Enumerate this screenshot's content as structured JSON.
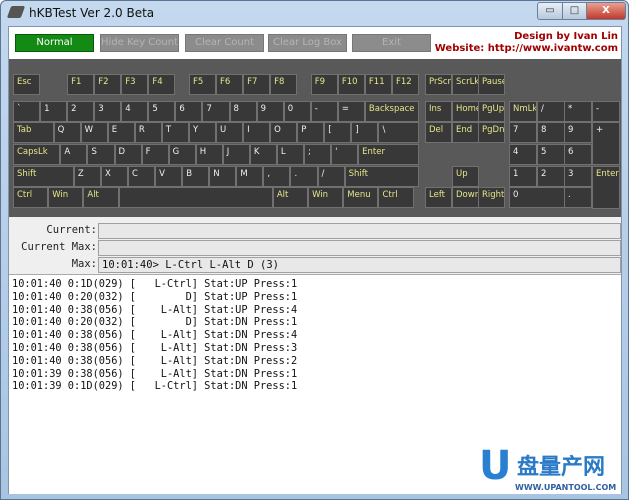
{
  "window": {
    "title": "hKBTest Ver 2.0 Beta",
    "minimize": "▭",
    "maximize": "□",
    "close": "X"
  },
  "toolbar": {
    "buttons": [
      "Normal",
      "Hide Key Count",
      "Clear Count",
      "Clear Log Box",
      "Exit"
    ],
    "credit_line1": "Design by Ivan Lin",
    "credit_line2": "Website: http://www.ivantw.com"
  },
  "keyboard": {
    "rows": [
      [
        "Esc",
        "F1",
        "F2",
        "F3",
        "F4",
        "F5",
        "F6",
        "F7",
        "F8",
        "F9",
        "F10",
        "F11",
        "F12",
        "PrScr",
        "ScrLk",
        "Pause"
      ],
      [
        "`",
        "1",
        "2",
        "3",
        "4",
        "5",
        "6",
        "7",
        "8",
        "9",
        "0",
        "-",
        "=",
        "Backspace",
        "Ins",
        "Home",
        "PgUp",
        "NmLk",
        "/",
        "*",
        "-"
      ],
      [
        "Tab",
        "Q",
        "W",
        "E",
        "R",
        "T",
        "Y",
        "U",
        "I",
        "O",
        "P",
        "[",
        "]",
        "\\",
        "Del",
        "End",
        "PgDn",
        "7",
        "8",
        "9",
        "+"
      ],
      [
        "CapsLk",
        "A",
        "S",
        "D",
        "F",
        "G",
        "H",
        "J",
        "K",
        "L",
        ";",
        "'",
        "Enter",
        "4",
        "5",
        "6"
      ],
      [
        "Shift",
        "Z",
        "X",
        "C",
        "V",
        "B",
        "N",
        "M",
        ",",
        ".",
        "/",
        "Shift",
        "Up",
        "1",
        "2",
        "3",
        "Enter"
      ],
      [
        "Ctrl",
        "Win",
        "Alt",
        "",
        "Alt",
        "Win",
        "Menu",
        "Ctrl",
        "Left",
        "Down",
        "Right",
        "0",
        "."
      ]
    ],
    "colors": {
      "background": "#595959",
      "key": "#383838",
      "special_label": "#e6e68a",
      "char_label": "#f0f0f0"
    }
  },
  "fields": {
    "current_label": "Current:",
    "current_value": "",
    "current_max_label": "Current Max:",
    "current_max_value": "",
    "max_label": "Max:",
    "max_value": "10:01:40> L-Ctrl L-Alt D (3)"
  },
  "log": [
    "10:01:40 0:1D(029) [   L-Ctrl] Stat:UP Press:1",
    "10:01:40 0:20(032) [        D] Stat:UP Press:1",
    "10:01:40 0:38(056) [    L-Alt] Stat:UP Press:4",
    "10:01:40 0:20(032) [        D] Stat:DN Press:1",
    "10:01:40 0:38(056) [    L-Alt] Stat:DN Press:4",
    "10:01:40 0:38(056) [    L-Alt] Stat:DN Press:3",
    "10:01:40 0:38(056) [    L-Alt] Stat:DN Press:2",
    "10:01:39 0:38(056) [    L-Alt] Stat:DN Press:1",
    "10:01:39 0:1D(029) [   L-Ctrl] Stat:DN Press:1"
  ],
  "watermark": {
    "letter": "U",
    "name": "盘量产网",
    "url": "WWW.UPANTOOL.COM"
  }
}
